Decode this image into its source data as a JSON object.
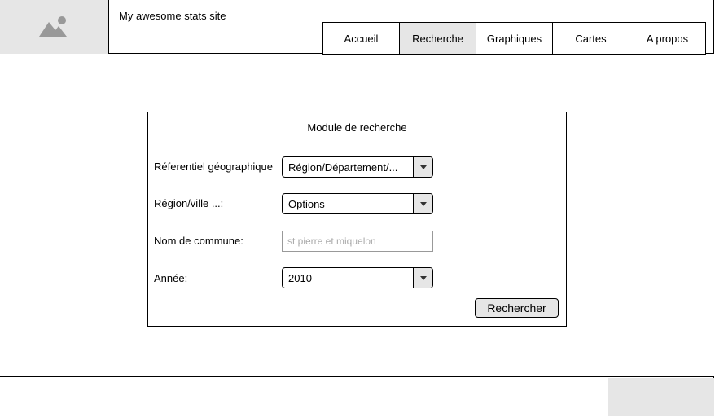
{
  "header": {
    "site_title": "My awesome stats site",
    "logo_icon": "image-placeholder-icon"
  },
  "nav": {
    "items": [
      {
        "label": "Accueil",
        "active": false
      },
      {
        "label": "Recherche",
        "active": true
      },
      {
        "label": "Graphiques",
        "active": false
      },
      {
        "label": "Cartes",
        "active": false
      },
      {
        "label": "A propos",
        "active": false
      }
    ]
  },
  "search_module": {
    "title": "Module de recherche",
    "geo_ref": {
      "label": "Réferentiel géographique",
      "value": "Région/Département/..."
    },
    "region": {
      "label": "Région/ville ...:",
      "value": "Options"
    },
    "commune": {
      "label": "Nom de commune:",
      "placeholder": "st pierre et miquelon"
    },
    "year": {
      "label": "Année:",
      "value": "2010"
    },
    "submit_label": "Rechercher"
  },
  "colors": {
    "placeholder_gray": "#e6e6e6",
    "border": "#000000"
  }
}
